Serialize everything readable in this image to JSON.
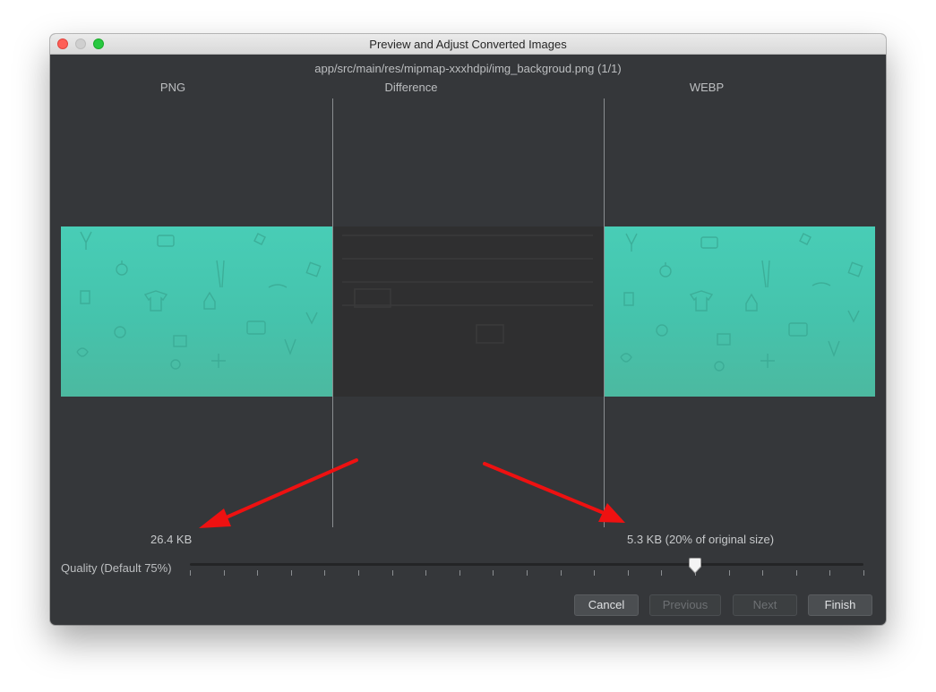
{
  "window": {
    "title": "Preview and Adjust Converted Images",
    "file_path": "app/src/main/res/mipmap-xxxhdpi/img_backgroud.png (1/1)"
  },
  "columns": {
    "png": "PNG",
    "difference": "Difference",
    "webp": "WEBP"
  },
  "sizes": {
    "png": "26.4 KB",
    "webp": "5.3 KB (20% of original size)"
  },
  "quality": {
    "label": "Quality (Default 75%)",
    "value": 75,
    "min": 0,
    "max": 100
  },
  "buttons": {
    "cancel": "Cancel",
    "previous": "Previous",
    "next": "Next",
    "finish": "Finish"
  },
  "colors": {
    "image_teal": "#48cdb6",
    "annotation_arrow": "#ee1111"
  }
}
